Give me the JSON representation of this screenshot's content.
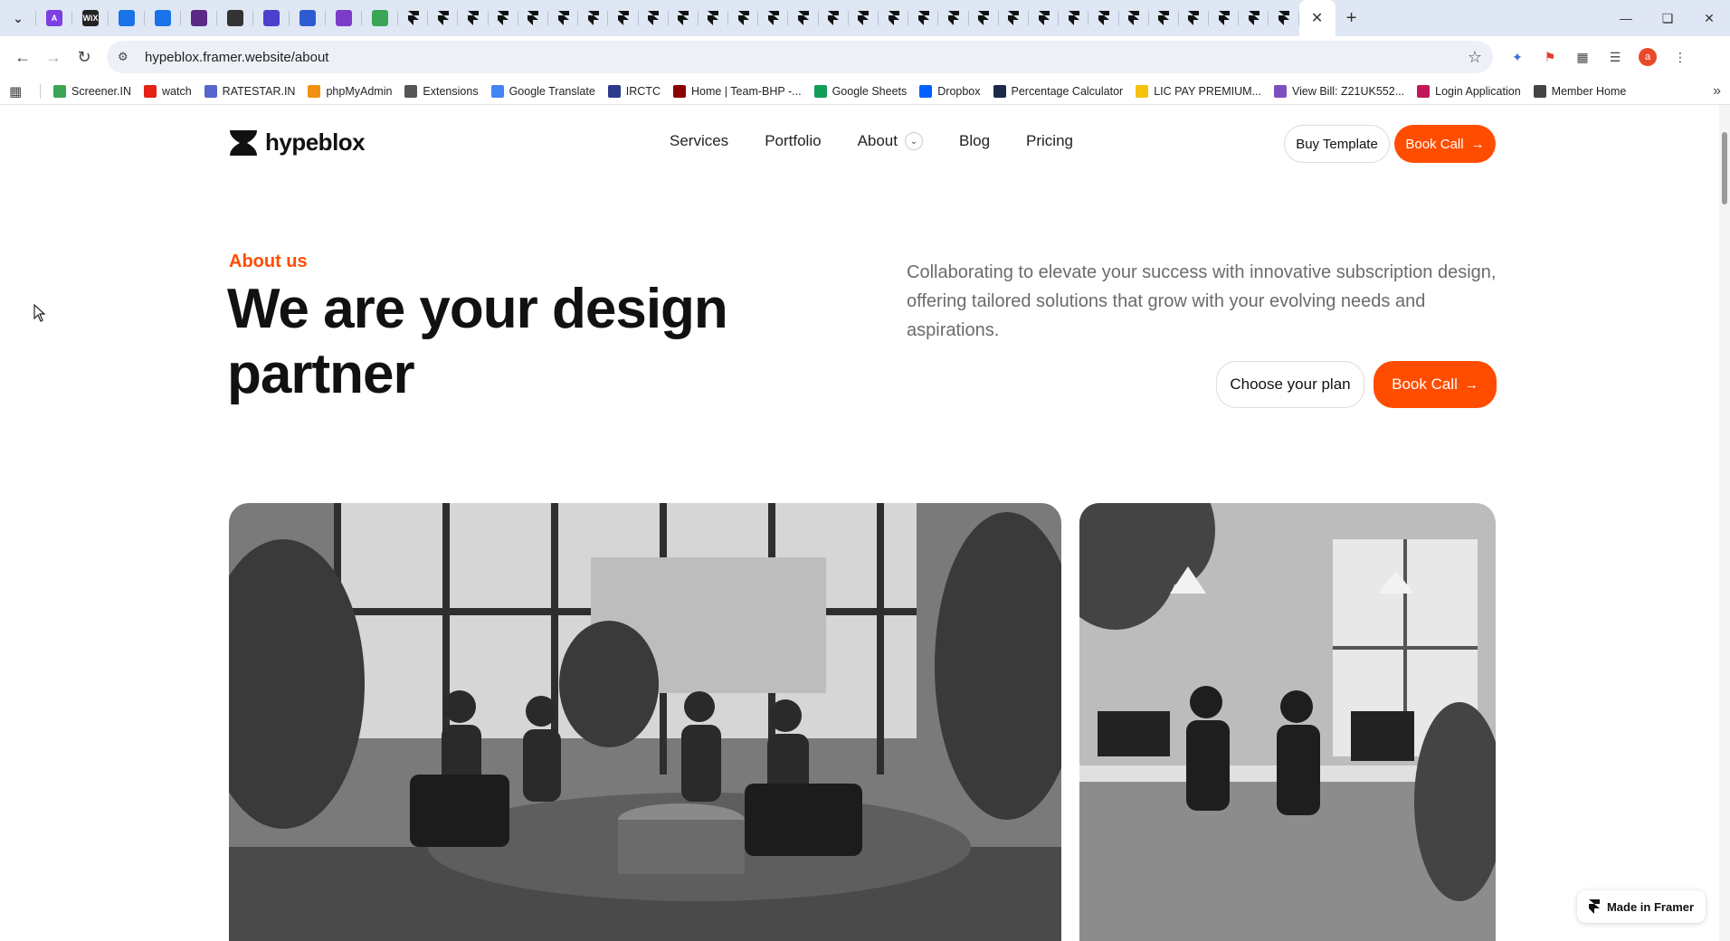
{
  "browser": {
    "address": "hypeblox.framer.website/about",
    "tabs_left": [
      {
        "icon": "tab-list-icon"
      },
      {
        "icon": "arc-icon",
        "color": "#7b3fe4",
        "text": "A"
      },
      {
        "icon": "wix-icon",
        "color": "#222222",
        "text": "WiX"
      },
      {
        "icon": "form-icon",
        "color": "#1a73e8",
        "text": ""
      },
      {
        "icon": "form-icon",
        "color": "#1a73e8",
        "text": ""
      },
      {
        "icon": "purple-app-icon",
        "color": "#5b2a86",
        "text": ""
      },
      {
        "icon": "swirl-icon",
        "color": "#333333",
        "text": ""
      },
      {
        "icon": "h-icon",
        "color": "#4b3fcf",
        "text": ""
      },
      {
        "icon": "calendar-icon",
        "color": "#2d5bd1",
        "text": ""
      },
      {
        "icon": "circle-app-icon",
        "color": "#7a3cc9",
        "text": ""
      },
      {
        "icon": "green-leaf-icon",
        "color": "#3aa655",
        "text": ""
      }
    ],
    "framer_tab_count": 30,
    "bookmarks": [
      {
        "label": "Screener.IN",
        "color": "#3aa655"
      },
      {
        "label": "watch",
        "color": "#e62117"
      },
      {
        "label": "RATESTAR.IN",
        "color": "#5566cc"
      },
      {
        "label": "phpMyAdmin",
        "color": "#f29111"
      },
      {
        "label": "Extensions",
        "color": "#555555"
      },
      {
        "label": "Google Translate",
        "color": "#4285f4"
      },
      {
        "label": "IRCTC",
        "color": "#2b3a8c"
      },
      {
        "label": "Home | Team-BHP -...",
        "color": "#8b0000"
      },
      {
        "label": "Google Sheets",
        "color": "#0f9d58"
      },
      {
        "label": "Dropbox",
        "color": "#0061fe"
      },
      {
        "label": "Percentage Calculator",
        "color": "#1b2a4a"
      },
      {
        "label": "LIC PAY PREMIUM...",
        "color": "#f4c20d"
      },
      {
        "label": "View Bill: Z21UK552...",
        "color": "#7b4fbf"
      },
      {
        "label": "Login Application",
        "color": "#c2185b"
      },
      {
        "label": "Member Home",
        "color": "#444444"
      }
    ]
  },
  "site": {
    "logo": "hypeblox",
    "nav": [
      "Services",
      "Portfolio",
      "About",
      "Blog",
      "Pricing"
    ],
    "buy_template": "Buy Template",
    "book_call": "Book Call",
    "eyebrow": "About us",
    "headline": "We are your design partner",
    "lead": "Collaborating to elevate your success with innovative subscription design, offering tailored solutions that grow with your evolving needs and aspirations.",
    "choose_plan": "Choose your plan",
    "book_call_hero": "Book Call",
    "badge": "Made in Framer",
    "accent": "#ff4d00"
  }
}
